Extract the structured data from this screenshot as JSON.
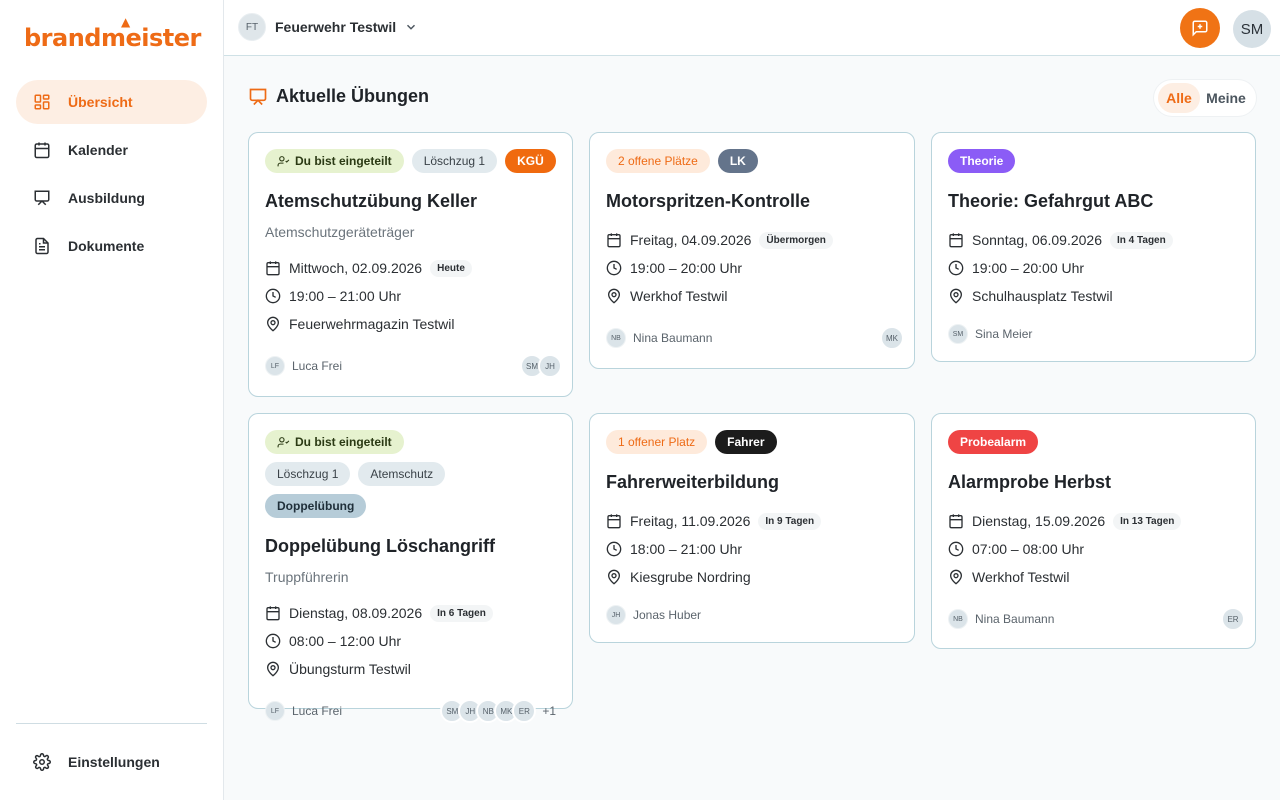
{
  "app": {
    "logo": "brandmeister"
  },
  "sidebar": {
    "items": [
      {
        "label": "Übersicht",
        "icon": "dashboard-icon",
        "active": true
      },
      {
        "label": "Kalender",
        "icon": "calendar-icon",
        "active": false
      },
      {
        "label": "Ausbildung",
        "icon": "presentation-icon",
        "active": false
      },
      {
        "label": "Dokumente",
        "icon": "document-icon",
        "active": false
      }
    ],
    "settings_label": "Einstellungen"
  },
  "topbar": {
    "org_initials": "FT",
    "org_name": "Feuerwehr Testwil",
    "user_initials": "SM"
  },
  "section": {
    "title": "Aktuelle Übungen",
    "filter_all": "Alle",
    "filter_mine": "Meine"
  },
  "cards": [
    {
      "badges": [
        "Du bist eingeteilt",
        "Löschzug 1",
        "KGÜ"
      ],
      "title": "Atemschutzübung Keller",
      "subtitle": "Atemschutzgeräteträger",
      "date": "Mittwoch, 02.09.2026",
      "relative": "Heute",
      "time": "19:00 – 21:00 Uhr",
      "location": "Feuerwehrmagazin Testwil",
      "leader_initials": "LF",
      "leader": "Luca Frei",
      "participants": [
        "SM",
        "JH"
      ],
      "extra": ""
    },
    {
      "badges": [
        "2 offene Plätze",
        "LK"
      ],
      "title": "Motorspritzen-Kontrolle",
      "subtitle": "",
      "date": "Freitag, 04.09.2026",
      "relative": "Übermorgen",
      "time": "19:00 – 20:00 Uhr",
      "location": "Werkhof Testwil",
      "leader_initials": "NB",
      "leader": "Nina Baumann",
      "participants": [
        "MK"
      ],
      "extra": ""
    },
    {
      "badges": [
        "Theorie"
      ],
      "title": "Theorie: Gefahrgut ABC",
      "subtitle": "",
      "date": "Sonntag, 06.09.2026",
      "relative": "In 4 Tagen",
      "time": "19:00 – 20:00 Uhr",
      "location": "Schulhausplatz Testwil",
      "leader_initials": "SM",
      "leader": "Sina Meier",
      "participants": [],
      "extra": ""
    },
    {
      "badges": [
        "Du bist eingeteilt",
        "Löschzug 1",
        "Atemschutz",
        "Doppelübung"
      ],
      "title": "Doppelübung Löschangriff",
      "subtitle": "Truppführerin",
      "date": "Dienstag, 08.09.2026",
      "relative": "In 6 Tagen",
      "time": "08:00 – 12:00 Uhr",
      "location": "Übungsturm Testwil",
      "leader_initials": "LF",
      "leader": "Luca Frei",
      "participants": [
        "SM",
        "JH",
        "NB",
        "MK",
        "ER"
      ],
      "extra": "+1"
    },
    {
      "badges": [
        "1 offener Platz",
        "Fahrer"
      ],
      "title": "Fahrerweiterbildung",
      "subtitle": "",
      "date": "Freitag, 11.09.2026",
      "relative": "In 9 Tagen",
      "time": "18:00 – 21:00 Uhr",
      "location": "Kiesgrube Nordring",
      "leader_initials": "JH",
      "leader": "Jonas Huber",
      "participants": [],
      "extra": ""
    },
    {
      "badges": [
        "Probealarm"
      ],
      "title": "Alarmprobe Herbst",
      "subtitle": "",
      "date": "Dienstag, 15.09.2026",
      "relative": "In 13 Tagen",
      "time": "07:00 – 08:00 Uhr",
      "location": "Werkhof Testwil",
      "leader_initials": "NB",
      "leader": "Nina Baumann",
      "participants": [
        "ER"
      ],
      "extra": ""
    }
  ]
}
